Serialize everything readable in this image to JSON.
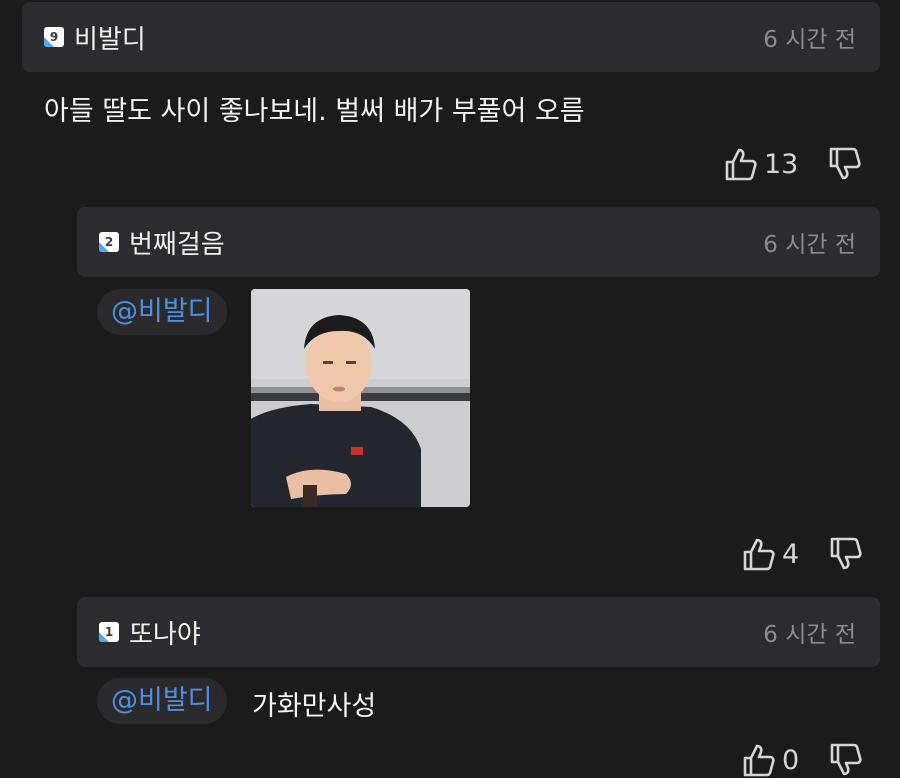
{
  "comments": [
    {
      "level": "9",
      "nickname": "비발디",
      "time": "6 시간 전",
      "text": "아들 딸도 사이 좋나보네. 벌써 배가 부풀어 오름",
      "likes": "13"
    },
    {
      "level": "2",
      "nickname": "번째걸음",
      "time": "6 시간 전",
      "mention": "@비발디",
      "likes": "4"
    },
    {
      "level": "1",
      "nickname": "또나야",
      "time": "6 시간 전",
      "mention": "@비발디",
      "text": "가화만사성",
      "likes": "0"
    }
  ],
  "icons": {
    "like": "thumbs-up-icon",
    "dislike": "thumbs-down-icon"
  },
  "colors": {
    "background": "#1b1b1c",
    "header": "#2c2c2e",
    "mention": "#4d8fe0",
    "muted": "#8c8c8c"
  }
}
